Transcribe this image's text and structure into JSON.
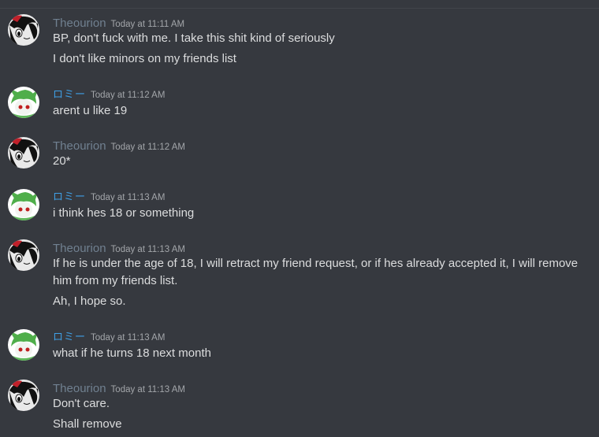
{
  "users": {
    "theourion": "Theourion",
    "romi": "ロミー"
  },
  "messages": [
    {
      "author": "Theourion",
      "timestamp": "Today at 11:11 AM",
      "lines": [
        "BP, don't fuck with me.  I take this shit kind of seriously",
        "I don't like minors on my friends list"
      ]
    },
    {
      "author": "ロミー",
      "timestamp": "Today at 11:12 AM",
      "lines": [
        "arent u like 19"
      ]
    },
    {
      "author": "Theourion",
      "timestamp": "Today at 11:12 AM",
      "lines": [
        "20*"
      ]
    },
    {
      "author": "ロミー",
      "timestamp": "Today at 11:13 AM",
      "lines": [
        "i think hes 18 or something"
      ]
    },
    {
      "author": "Theourion",
      "timestamp": "Today at 11:13 AM",
      "lines": [
        "If he is under the age of 18, I will retract my friend request, or if hes already accepted it, I will remove him from my friends list.",
        "Ah, I hope so."
      ]
    },
    {
      "author": "ロミー",
      "timestamp": "Today at 11:13 AM",
      "lines": [
        "what if he turns 18 next month"
      ]
    },
    {
      "author": "Theourion",
      "timestamp": "Today at 11:13 AM",
      "lines": [
        "Don't care.",
        "Shall remove"
      ]
    }
  ],
  "colors": {
    "background": "#36393f",
    "text": "#dcddde",
    "username_theourion": "#708090",
    "username_romi": "#3fa0e6",
    "timestamp": "#a3a6aa"
  }
}
